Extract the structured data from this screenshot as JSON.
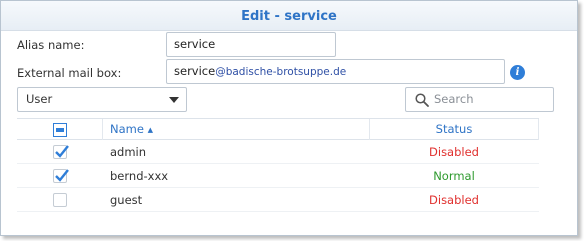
{
  "dialog": {
    "title": "Edit - service"
  },
  "form": {
    "alias_label": "Alias name:",
    "alias_value": "service",
    "mailbox_label": "External mail box:",
    "mailbox_user": "service",
    "mailbox_domain": "@badische-brotsuppe.de",
    "info_icon": "info-icon"
  },
  "toolbar": {
    "select_value": "User",
    "search_placeholder": "Search"
  },
  "table": {
    "columns": [
      "Name",
      "Status"
    ],
    "sort_indicator": "▲",
    "rows": [
      {
        "name": "admin",
        "status": "Disabled",
        "checked": true
      },
      {
        "name": "bernd-xxx",
        "status": "Normal",
        "checked": true
      },
      {
        "name": "guest",
        "status": "Disabled",
        "checked": false
      }
    ]
  },
  "colors": {
    "accent": "#2f74c6",
    "disabled": "#e0302e",
    "normal": "#2e9a2e"
  }
}
